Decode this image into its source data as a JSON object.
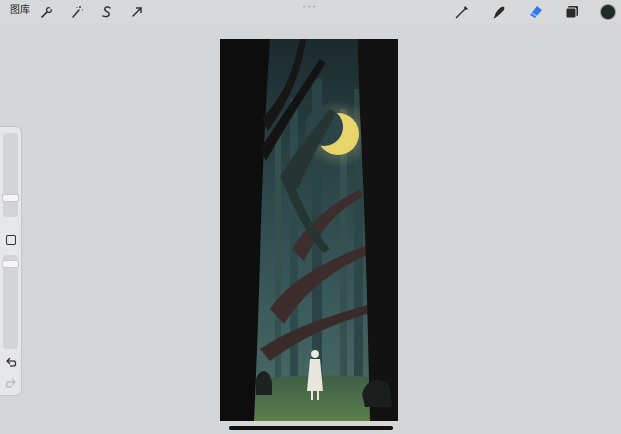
{
  "toolbar": {
    "gallery_label": "图库",
    "left_tools": [
      {
        "icon": "wrench-icon"
      },
      {
        "icon": "magic-wand-icon"
      },
      {
        "icon": "selection-s-icon"
      },
      {
        "icon": "transform-arrow-icon"
      }
    ],
    "right_tools": [
      {
        "icon": "brush-icon"
      },
      {
        "icon": "smudge-icon"
      },
      {
        "icon": "eraser-icon",
        "active": true
      },
      {
        "icon": "layers-icon"
      }
    ],
    "active_color": "#1e2b27",
    "accent_color": "#2f7bf5"
  },
  "sidebar": {
    "brush_size_level": 0.15,
    "opacity_level": 0.95
  },
  "canvas": {
    "artwork": "forest-moon-illustration"
  }
}
